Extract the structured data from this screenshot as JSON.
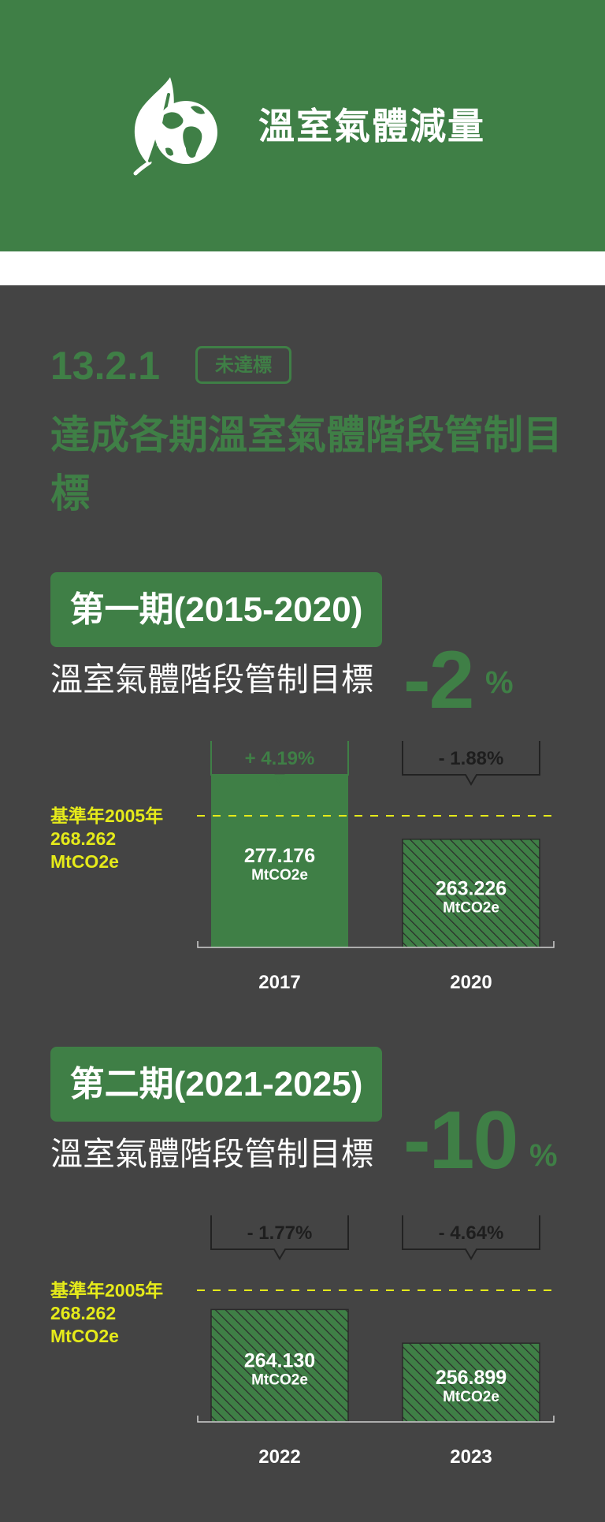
{
  "header": {
    "title": "溫室氣體減量",
    "icon": "leaf-globe-icon",
    "background_color": "#3f7f46"
  },
  "section": {
    "number": "13.2.1",
    "status": "未達標",
    "title": "達成各期溫室氣體階段管制目標"
  },
  "colors": {
    "accent": "#3f7f46",
    "background": "#444444",
    "baseline": "#e5ea1a",
    "hatch": "#2f5a33"
  },
  "chart_data": [
    {
      "type": "bar",
      "period_label": "第一期(2015-2020)",
      "target_label": "溫室氣體階段管制目標",
      "target_value": "-2",
      "target_unit": "%",
      "baseline": {
        "lines": [
          "基準年2005年",
          "268.262",
          "MtCO2e"
        ],
        "value": 268.262
      },
      "unit": "MtCO2e",
      "ylim": [
        240,
        270
      ],
      "categories": [
        "2017",
        "2020"
      ],
      "values": [
        277.176,
        263.226
      ],
      "value_labels": [
        "277.176",
        "263.226"
      ],
      "changes": [
        "+ 4.19%",
        "- 1.88%"
      ],
      "styles": [
        "solid",
        "hatched"
      ]
    },
    {
      "type": "bar",
      "period_label": "第二期(2021-2025)",
      "target_label": "溫室氣體階段管制目標",
      "target_value": "-10",
      "target_unit": "%",
      "baseline": {
        "lines": [
          "基準年2005年",
          "268.262",
          "MtCO2e"
        ],
        "value": 268.262
      },
      "unit": "MtCO2e",
      "ylim": [
        240,
        270
      ],
      "categories": [
        "2022",
        "2023"
      ],
      "values": [
        264.13,
        256.899
      ],
      "value_labels": [
        "264.130",
        "256.899"
      ],
      "changes": [
        "- 1.77%",
        "- 4.64%"
      ],
      "styles": [
        "hatched",
        "hatched"
      ]
    }
  ]
}
